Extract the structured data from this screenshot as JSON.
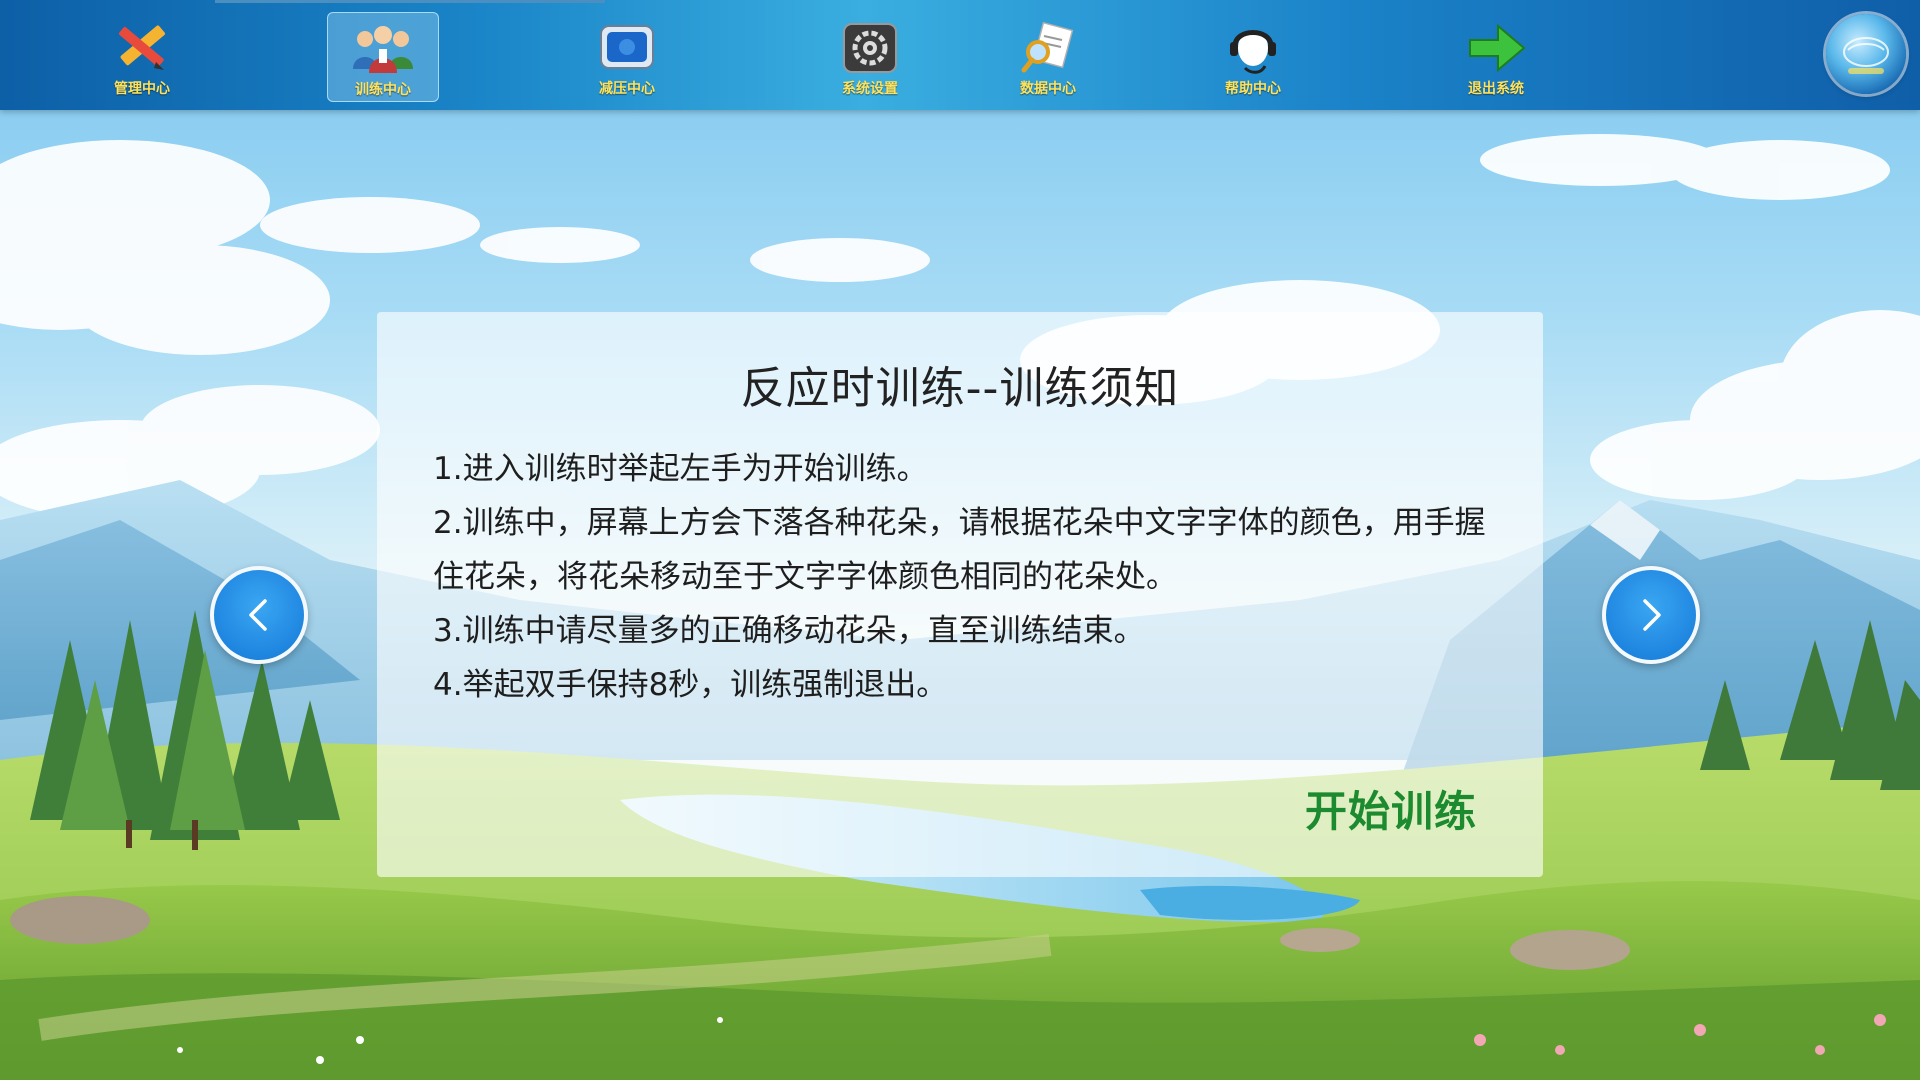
{
  "nav": {
    "items": [
      {
        "label": "管理中心",
        "icon": "pencil-ruler-icon"
      },
      {
        "label": "训练中心",
        "icon": "users-icon",
        "active": true
      },
      {
        "label": "减压中心",
        "icon": "tv-icon"
      },
      {
        "label": "系统设置",
        "icon": "gear-icon"
      },
      {
        "label": "数据中心",
        "icon": "magnifier-document-icon"
      },
      {
        "label": "帮助中心",
        "icon": "headset-icon"
      },
      {
        "label": "退出系统",
        "icon": "green-arrow-icon"
      }
    ]
  },
  "panel": {
    "title": "反应时训练--训练须知",
    "rules": [
      "1.进入训练时举起左手为开始训练。",
      "2.训练中，屏幕上方会下落各种花朵，请根据花朵中文字字体的颜色，用手握住花朵，将花朵移动至于文字字体颜色相同的花朵处。",
      "3.训练中请尽量多的正确移动花朵，直至训练结束。",
      "4.举起双手保持8秒，训练强制退出。"
    ],
    "start_label": "开始训练"
  },
  "colors": {
    "accent_green": "#1c8a2e",
    "nav_label": "#ffe25a",
    "arrow_blue": "#1f86e0"
  }
}
